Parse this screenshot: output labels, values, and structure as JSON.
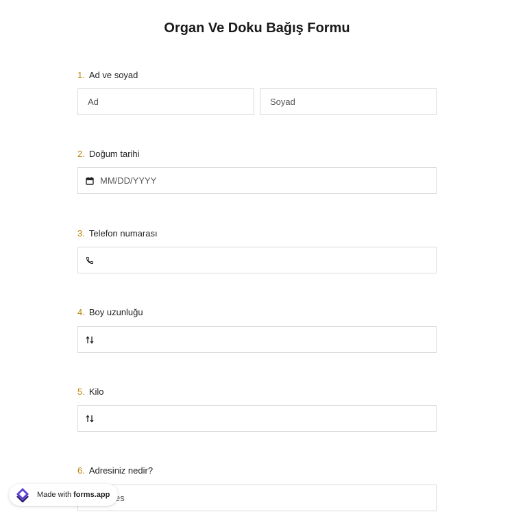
{
  "form": {
    "title": "Organ Ve Doku Bağış Formu"
  },
  "questions": [
    {
      "number": "1.",
      "label": "Ad ve soyad",
      "first_placeholder": "Ad",
      "last_placeholder": "Soyad"
    },
    {
      "number": "2.",
      "label": "Doğum tarihi",
      "placeholder": "MM/DD/YYYY",
      "icon": "calendar-icon"
    },
    {
      "number": "3.",
      "label": "Telefon numarası",
      "placeholder": "",
      "icon": "phone-icon"
    },
    {
      "number": "4.",
      "label": "Boy uzunluğu",
      "placeholder": "",
      "icon": "number-arrows-icon"
    },
    {
      "number": "5.",
      "label": "Kilo",
      "placeholder": "",
      "icon": "number-arrows-icon"
    },
    {
      "number": "6.",
      "label": "Adresiniz nedir?",
      "placeholder": "es"
    }
  ],
  "badge": {
    "prefix": "Made with",
    "brand": "forms.app"
  },
  "colors": {
    "question_number": "#b8860b",
    "border": "#d9d9d9",
    "logo_primary": "#5b3fd6",
    "logo_secondary": "#2d1b69"
  }
}
